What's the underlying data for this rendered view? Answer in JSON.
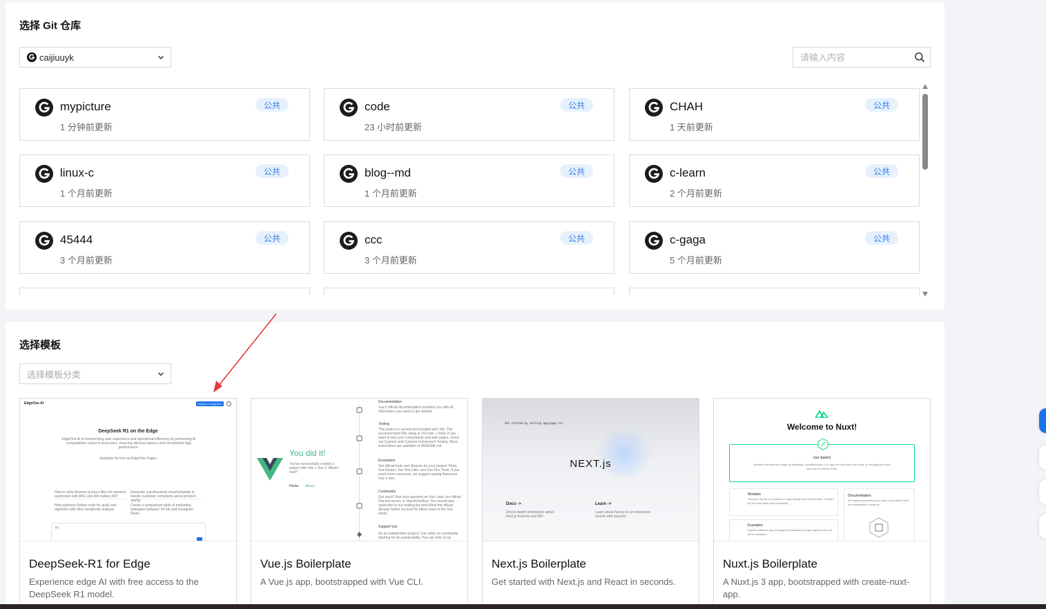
{
  "git_section": {
    "title": "选择 Git 仓库",
    "owner": "caijiuuyk",
    "search_placeholder": "请输入内容",
    "repos": [
      {
        "name": "mypicture",
        "updated": "1 分钟前更新",
        "visibility": "公共"
      },
      {
        "name": "code",
        "updated": "23 小时前更新",
        "visibility": "公共"
      },
      {
        "name": "CHAH",
        "updated": "1 天前更新",
        "visibility": "公共"
      },
      {
        "name": "linux-c",
        "updated": "1 个月前更新",
        "visibility": "公共"
      },
      {
        "name": "blog--md",
        "updated": "1 个月前更新",
        "visibility": "公共"
      },
      {
        "name": "c-learn",
        "updated": "2 个月前更新",
        "visibility": "公共"
      },
      {
        "name": "45444",
        "updated": "3 个月前更新",
        "visibility": "公共"
      },
      {
        "name": "ccc",
        "updated": "3 个月前更新",
        "visibility": "公共"
      },
      {
        "name": "c-gaga",
        "updated": "5 个月前更新",
        "visibility": "公共"
      }
    ]
  },
  "template_section": {
    "title": "选择模板",
    "category_placeholder": "选择模板分类",
    "templates": [
      {
        "name": "DeepSeek-R1 for Edge",
        "description": "Experience edge AI with free access to the DeepSeek R1 model.",
        "preview": {
          "brand": "EdgeOne AI",
          "deploy_button": "Deploy to EdgeOne",
          "heading": "DeepSeek R1 on the Edge",
          "intro": "EdgeOne AI is transforming user experience and operational efficiency by performing AI computations closer to end-users, ensuring ultra-low latency and consistently high performance.",
          "available": "Available for free on EdgeOne Pages",
          "prompts": [
            "How to write Amazon product titles for wireless earphones with ANC and 40h battery life?",
            "Generate a professional email template to handle customer complaints about product quality",
            "Help optimize Python code for quick sort algorithm with time complexity analysis",
            "Create a comparison table of marketing strategies between TikTok and Instagram Reels"
          ],
          "input_text": "Hi"
        }
      },
      {
        "name": "Vue.js Boilerplate",
        "description": "A Vue.js app, bootstrapped with Vue CLI.",
        "preview": {
          "headline": "You did it!",
          "subline": "You've successfully created a project with Vite + Vue 3. What's next?",
          "nav": [
            "Home",
            "About"
          ],
          "sections": [
            {
              "title": "Documentation",
              "text": "Vue's official documentation provides you with all information you need to get started."
            },
            {
              "title": "Tooling",
              "text": "This project is served and bundled with Vite. The recommended IDE setup is VSCode + Volar. If you need to test your components and web pages, check out Cypress and Cypress Component Testing. More instructions are available in README.md."
            },
            {
              "title": "Ecosystem",
              "text": "Get official tools and libraries for your project: Pinia, Vue Router, Vue Test Utils, and Vue Dev Tools. If you need more resources, we suggest paying Awesome Vue a visit."
            },
            {
              "title": "Community",
              "text": "Got stuck? Ask your question on Vue Land, our official Discord server, or StackOverflow. You should also subscribe to our mailing list and follow the official @vuejs twitter account for latest news in the Vue world."
            },
            {
              "title": "Support Vue",
              "text": "As an independent project, Vue relies on community backing for its sustainability. You can help us by"
            }
          ]
        }
      },
      {
        "name": "Next.js Boilerplate",
        "description": "Get started with Next.js and React in seconds.",
        "preview": {
          "code_hint": "Get started by editing app/page.tsx",
          "logo": "NEXT.js",
          "links": [
            {
              "title": "Docs ->",
              "text": "Find in-depth information about Next.js features and API."
            },
            {
              "title": "Learn ->",
              "text": "Learn about Next.js in an interactive course with quizzes!"
            }
          ]
        }
      },
      {
        "name": "Nuxt.js Boilerplate",
        "description": "A Nuxt.js 3 app, bootstrapped with create-nuxt-app.",
        "preview": {
          "heading": "Welcome to Nuxt!",
          "get_started": "Get started",
          "get_started_text": "Remove this welcome page by replacing <NuxtWelcome /> in app.vue with your own code, or creating your own app.vue if it doesn't exist.",
          "cards": [
            {
              "title": "Modules",
              "text": "Discover our list of modules to supercharge your Nuxt project. Created by the Nuxt team and community."
            },
            {
              "title": "Documentation",
              "text": "We highly recommend you take a look at the Nuxt documentation to level up."
            },
            {
              "title": "Examples",
              "text": "Explore different way of using Nuxt features and get inspired with our list of examples."
            }
          ]
        }
      }
    ]
  },
  "colors": {
    "badge_bg": "#e7f1fd",
    "badge_text": "#2f7ee6",
    "vue_green": "#42b883",
    "nuxt_green": "#00dc82",
    "annotation_arrow": "#e53935",
    "accent_blue": "#1a73e8"
  }
}
